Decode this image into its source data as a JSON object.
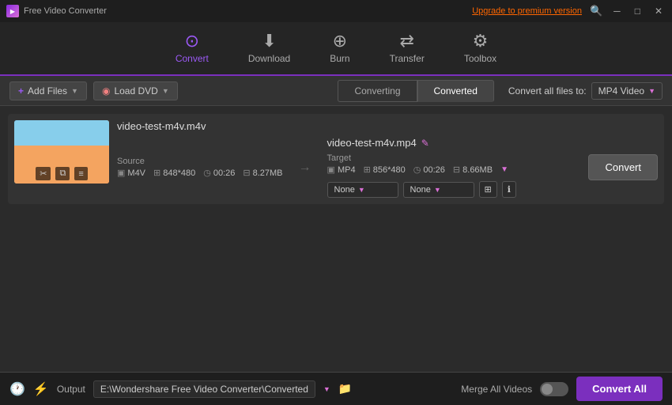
{
  "titlebar": {
    "app_name": "Free Video Converter",
    "upgrade_text": "Upgrade to premium version",
    "win_min": "─",
    "win_max": "□",
    "win_close": "✕"
  },
  "nav": {
    "items": [
      {
        "id": "convert",
        "label": "Convert",
        "icon": "⊙",
        "active": true
      },
      {
        "id": "download",
        "label": "Download",
        "icon": "⬇"
      },
      {
        "id": "burn",
        "label": "Burn",
        "icon": "⊕"
      },
      {
        "id": "transfer",
        "label": "Transfer",
        "icon": "⇄"
      },
      {
        "id": "toolbox",
        "label": "Toolbox",
        "icon": "⚙"
      }
    ]
  },
  "toolbar": {
    "add_files": "+ Add Files",
    "load_dvd": "Load DVD",
    "tabs": [
      "Converting",
      "Converted"
    ],
    "active_tab": "Converted",
    "convert_all_label": "Convert all files to:",
    "format_value": "MP4 Video"
  },
  "file": {
    "name": "video-test-m4v.m4v",
    "source_label": "Source",
    "source_format": "M4V",
    "source_resolution": "848*480",
    "source_duration": "00:26",
    "source_size": "8.27MB",
    "target_filename": "video-test-m4v.mp4",
    "target_label": "Target",
    "target_format": "MP4",
    "target_resolution": "856*480",
    "target_duration": "00:26",
    "target_size": "8.66MB",
    "effect1": "None",
    "effect2": "None",
    "convert_btn_label": "Convert"
  },
  "bottom": {
    "output_label": "Output",
    "output_path": "E:\\Wondershare Free Video Converter\\Converted",
    "merge_label": "Merge All Videos",
    "convert_all_label": "Convert All"
  }
}
